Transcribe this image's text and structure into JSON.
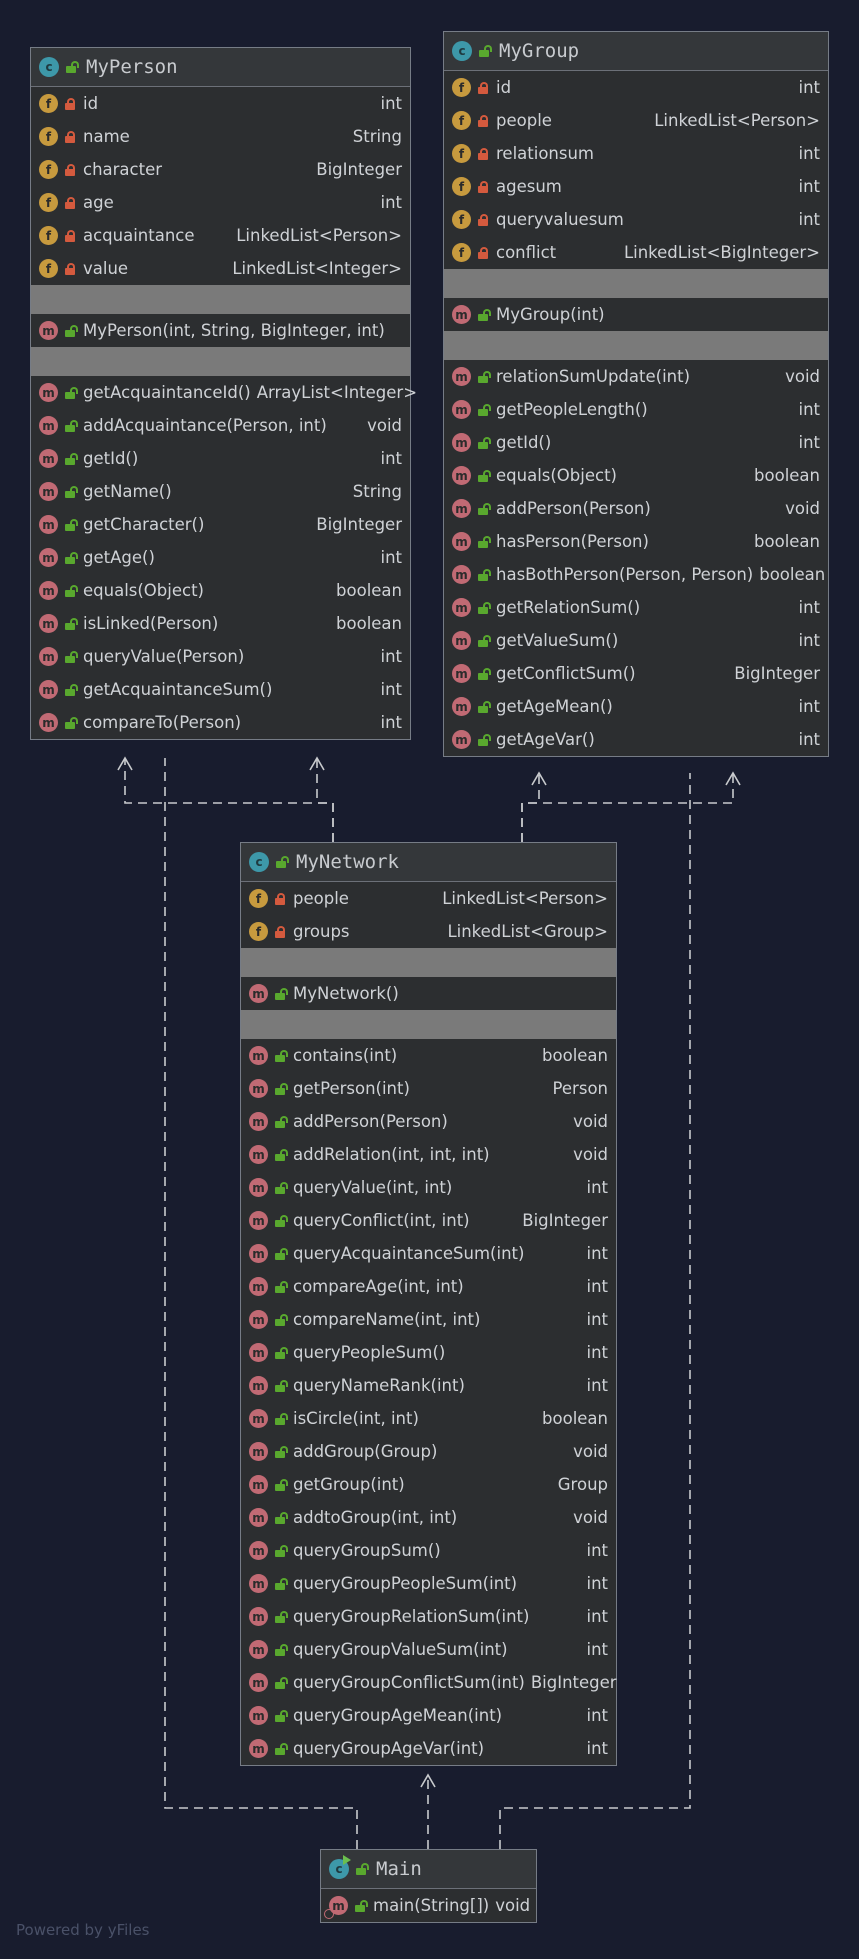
{
  "classes": {
    "person": {
      "title": "MyPerson",
      "fields": [
        {
          "name": "id",
          "type": "int"
        },
        {
          "name": "name",
          "type": "String"
        },
        {
          "name": "character",
          "type": "BigInteger"
        },
        {
          "name": "age",
          "type": "int"
        },
        {
          "name": "acquaintance",
          "type": "LinkedList<Person>"
        },
        {
          "name": "value",
          "type": "LinkedList<Integer>"
        }
      ],
      "constructors": [
        {
          "name": "MyPerson(int, String, BigInteger, int)",
          "type": ""
        }
      ],
      "methods": [
        {
          "name": "getAcquaintanceId()",
          "type": "ArrayList<Integer>"
        },
        {
          "name": "addAcquaintance(Person, int)",
          "type": "void"
        },
        {
          "name": "getId()",
          "type": "int"
        },
        {
          "name": "getName()",
          "type": "String"
        },
        {
          "name": "getCharacter()",
          "type": "BigInteger"
        },
        {
          "name": "getAge()",
          "type": "int"
        },
        {
          "name": "equals(Object)",
          "type": "boolean"
        },
        {
          "name": "isLinked(Person)",
          "type": "boolean"
        },
        {
          "name": "queryValue(Person)",
          "type": "int"
        },
        {
          "name": "getAcquaintanceSum()",
          "type": "int"
        },
        {
          "name": "compareTo(Person)",
          "type": "int"
        }
      ]
    },
    "group": {
      "title": "MyGroup",
      "fields": [
        {
          "name": "id",
          "type": "int"
        },
        {
          "name": "people",
          "type": "LinkedList<Person>"
        },
        {
          "name": "relationsum",
          "type": "int"
        },
        {
          "name": "agesum",
          "type": "int"
        },
        {
          "name": "queryvaluesum",
          "type": "int"
        },
        {
          "name": "conflict",
          "type": "LinkedList<BigInteger>"
        }
      ],
      "constructors": [
        {
          "name": "MyGroup(int)",
          "type": ""
        }
      ],
      "methods": [
        {
          "name": "relationSumUpdate(int)",
          "type": "void"
        },
        {
          "name": "getPeopleLength()",
          "type": "int"
        },
        {
          "name": "getId()",
          "type": "int"
        },
        {
          "name": "equals(Object)",
          "type": "boolean"
        },
        {
          "name": "addPerson(Person)",
          "type": "void"
        },
        {
          "name": "hasPerson(Person)",
          "type": "boolean"
        },
        {
          "name": "hasBothPerson(Person, Person)",
          "type": "boolean"
        },
        {
          "name": "getRelationSum()",
          "type": "int"
        },
        {
          "name": "getValueSum()",
          "type": "int"
        },
        {
          "name": "getConflictSum()",
          "type": "BigInteger"
        },
        {
          "name": "getAgeMean()",
          "type": "int"
        },
        {
          "name": "getAgeVar()",
          "type": "int"
        }
      ]
    },
    "network": {
      "title": "MyNetwork",
      "fields": [
        {
          "name": "people",
          "type": "LinkedList<Person>"
        },
        {
          "name": "groups",
          "type": "LinkedList<Group>"
        }
      ],
      "constructors": [
        {
          "name": "MyNetwork()",
          "type": ""
        }
      ],
      "methods": [
        {
          "name": "contains(int)",
          "type": "boolean"
        },
        {
          "name": "getPerson(int)",
          "type": "Person"
        },
        {
          "name": "addPerson(Person)",
          "type": "void"
        },
        {
          "name": "addRelation(int, int, int)",
          "type": "void"
        },
        {
          "name": "queryValue(int, int)",
          "type": "int"
        },
        {
          "name": "queryConflict(int, int)",
          "type": "BigInteger"
        },
        {
          "name": "queryAcquaintanceSum(int)",
          "type": "int"
        },
        {
          "name": "compareAge(int, int)",
          "type": "int"
        },
        {
          "name": "compareName(int, int)",
          "type": "int"
        },
        {
          "name": "queryPeopleSum()",
          "type": "int"
        },
        {
          "name": "queryNameRank(int)",
          "type": "int"
        },
        {
          "name": "isCircle(int, int)",
          "type": "boolean"
        },
        {
          "name": "addGroup(Group)",
          "type": "void"
        },
        {
          "name": "getGroup(int)",
          "type": "Group"
        },
        {
          "name": "addtoGroup(int, int)",
          "type": "void"
        },
        {
          "name": "queryGroupSum()",
          "type": "int"
        },
        {
          "name": "queryGroupPeopleSum(int)",
          "type": "int"
        },
        {
          "name": "queryGroupRelationSum(int)",
          "type": "int"
        },
        {
          "name": "queryGroupValueSum(int)",
          "type": "int"
        },
        {
          "name": "queryGroupConflictSum(int)",
          "type": "BigInteger"
        },
        {
          "name": "queryGroupAgeMean(int)",
          "type": "int"
        },
        {
          "name": "queryGroupAgeVar(int)",
          "type": "int"
        }
      ]
    },
    "main": {
      "title": "Main",
      "methods": [
        {
          "name": "main(String[])",
          "type": "void"
        }
      ]
    }
  },
  "badges": {
    "class": "c",
    "field": "f",
    "method": "m"
  },
  "footer": "Powered by yFiles",
  "colors": {
    "background": "#181c2e",
    "connector": "#c8cacd",
    "field_badge": "#c79a3e",
    "method_badge": "#c16a74",
    "class_badge": "#3d98a9",
    "private_lock": "#d45a3e",
    "public_lock": "#59a82e"
  }
}
